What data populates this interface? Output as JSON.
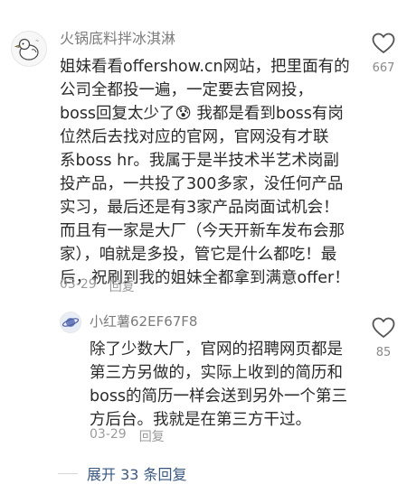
{
  "comment": {
    "username": "火锅底料拌冰淇淋",
    "lines": [
      "姐妹看看offershow.cn网站，把里面有的",
      "公司全都投一遍，一定要去官网投，",
      "boss回复太少了😰 我都是看到boss有岗",
      "位然后去找对应的官网，官网没有才联",
      "系boss hr。我属于是半技术半艺术岗副",
      "投产品，一共投了300多家，没任何产品",
      "实习，最后还是有3家产品岗面试机会！",
      "而且有一家是大厂（今天开新车发布会那",
      "家），咱就是多投，管它是什么都吃！最",
      "后，祝刷到我的姐妹全都拿到满意offer！"
    ],
    "date": "03-29",
    "reply_label": "回复",
    "like_count": "667",
    "avatar_icon": "cartoon-goose-avatar"
  },
  "reply": {
    "username": "小红薯62EF67F8",
    "lines": [
      "除了少数大厂，官网的招聘网页都是",
      "第三方另做的，实际上收到的简历和",
      "boss的简历一样会送到另外一个第三",
      "方后台。我就是在第三方干过。"
    ],
    "date": "03-29",
    "reply_label": "回复",
    "like_count": "85",
    "avatar_icon": "planet-avatar"
  },
  "expand_label": "展开 33 条回复",
  "colors": {
    "username": "#7b7b7b",
    "body": "#2a2a2a",
    "meta": "#9b9b9b",
    "link": "#3a5780"
  }
}
